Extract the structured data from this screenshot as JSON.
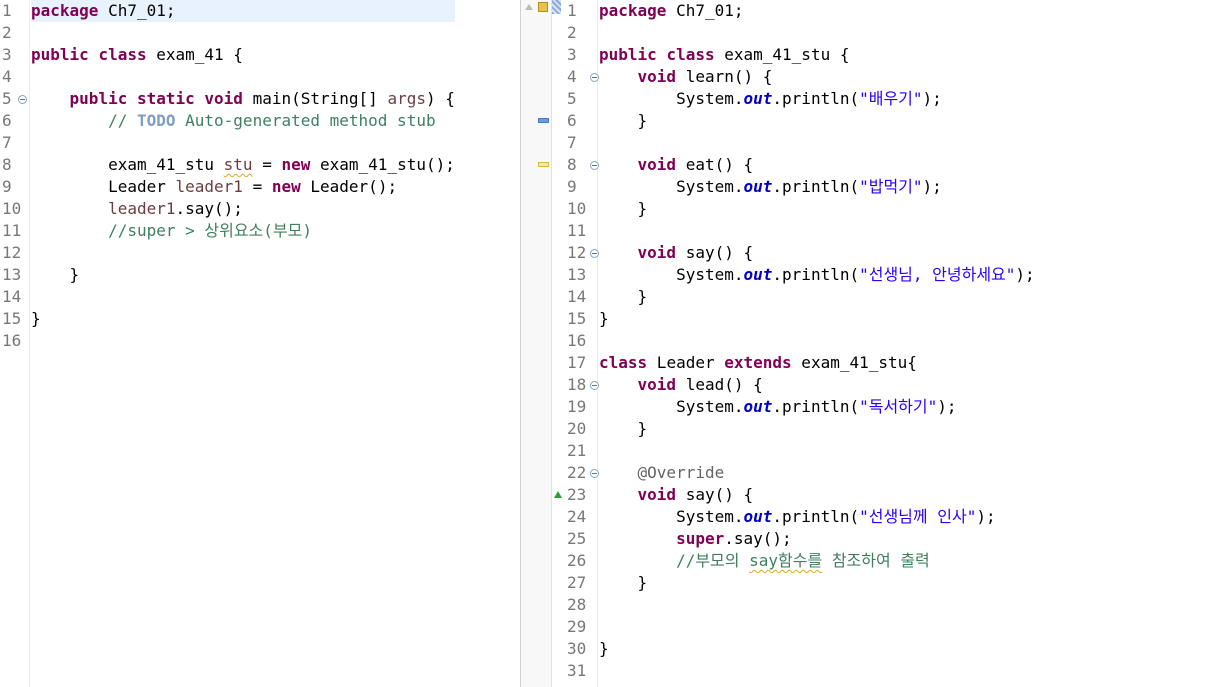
{
  "left_editor": {
    "line_numbers": [
      "1",
      "2",
      "3",
      "4",
      "5",
      "6",
      "7",
      "8",
      "9",
      "10",
      "11",
      "12",
      "13",
      "14",
      "15",
      "16"
    ],
    "fold_lines": [
      5
    ],
    "code": {
      "l1": {
        "kw_package": "package",
        "rest": " Ch7_01;"
      },
      "l3": {
        "kw_public": "public",
        "kw_class": "class",
        "rest": " exam_41 {"
      },
      "l5": {
        "kw_public": "public",
        "kw_static": "static",
        "kw_void": "void",
        "sig": " main(String[] ",
        "param": "args",
        "end": ") {"
      },
      "l6": {
        "comment_start": "// ",
        "todo": "TODO",
        "comment_end": " Auto-generated method stub"
      },
      "l8": {
        "type": "exam_41_stu ",
        "var": "stu",
        "eq": " = ",
        "kw_new": "new",
        "ctor": " exam_41_stu();"
      },
      "l9": {
        "type": "Leader ",
        "var": "leader1",
        "eq": " = ",
        "kw_new": "new",
        "ctor": " Leader();"
      },
      "l10": {
        "var": "leader1",
        "call": ".say();"
      },
      "l11": {
        "comment": "//super > 상위요소(부모)"
      },
      "l13": {
        "brace": "}"
      },
      "l15": {
        "brace": "}"
      }
    }
  },
  "right_editor": {
    "line_numbers": [
      "1",
      "2",
      "3",
      "4",
      "5",
      "6",
      "7",
      "8",
      "9",
      "10",
      "11",
      "12",
      "13",
      "14",
      "15",
      "16",
      "17",
      "18",
      "19",
      "20",
      "21",
      "22",
      "23",
      "24",
      "25",
      "26",
      "27",
      "28",
      "29",
      "30",
      "31"
    ],
    "fold_lines": [
      4,
      8,
      12,
      18,
      22
    ],
    "override_marker_line": 23,
    "code": {
      "l1": {
        "kw_package": "package",
        "rest": " Ch7_01;"
      },
      "l3": {
        "kw_public": "public",
        "kw_class": "class",
        "rest": " exam_41_stu {"
      },
      "l4": {
        "kw_void": "void",
        "rest": " learn() {"
      },
      "l5": {
        "pre": "System.",
        "fld": "out",
        "mid": ".println(",
        "str": "\"배우기\"",
        "end": ");"
      },
      "l6": {
        "brace": "}"
      },
      "l8": {
        "kw_void": "void",
        "rest": " eat() {"
      },
      "l9": {
        "pre": "System.",
        "fld": "out",
        "mid": ".println(",
        "str": "\"밥먹기\"",
        "end": ");"
      },
      "l10": {
        "brace": "}"
      },
      "l12": {
        "kw_void": "void",
        "rest": " say() {"
      },
      "l13": {
        "pre": "System.",
        "fld": "out",
        "mid": ".println(",
        "str": "\"선생님, 안녕하세요\"",
        "end": ");"
      },
      "l14": {
        "brace": "}"
      },
      "l15": {
        "brace": "}"
      },
      "l17": {
        "kw_class": "class",
        "name": " Leader ",
        "kw_extends": "extends",
        "rest": " exam_41_stu{"
      },
      "l18": {
        "kw_void": "void",
        "rest": " lead() {"
      },
      "l19": {
        "pre": "System.",
        "fld": "out",
        "mid": ".println(",
        "str": "\"독서하기\"",
        "end": ");"
      },
      "l20": {
        "brace": "}"
      },
      "l22": {
        "annotation": "@Override"
      },
      "l23": {
        "kw_void": "void",
        "rest": " say() {"
      },
      "l24": {
        "pre": "System.",
        "fld": "out",
        "mid": ".println(",
        "str": "\"선생님께 인사\"",
        "end": ");"
      },
      "l25": {
        "kw_super": "super",
        "rest": ".say();"
      },
      "l26": {
        "c1": "//부모의 ",
        "c2": "say함수를",
        "c3": " 참조하여 출력"
      },
      "l27": {
        "brace": "}"
      },
      "l30": {
        "brace": "}"
      }
    }
  },
  "colors": {
    "keyword": "#7f0055",
    "comment": "#3f7f5f",
    "todo": "#7f9fbf",
    "string": "#2a00ff",
    "static_field": "#0000c0",
    "annotation": "#646464",
    "line_number": "#787878",
    "current_line": "#e8f2fe",
    "override_marker": "#2e9c3a"
  }
}
